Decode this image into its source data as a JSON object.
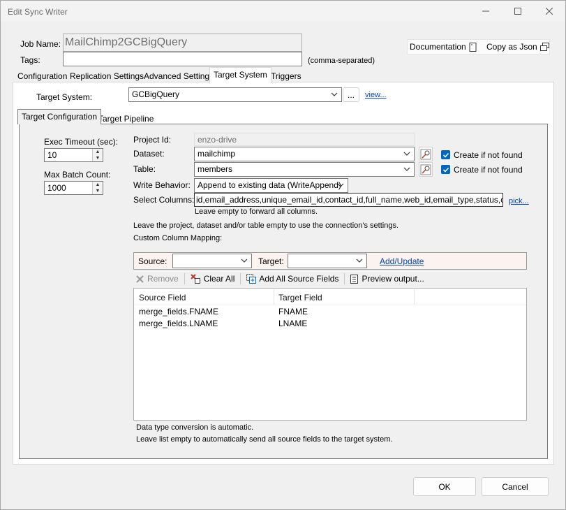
{
  "window": {
    "title": "Edit Sync Writer",
    "minimize_icon": "minimize-icon",
    "maximize_icon": "maximize-icon",
    "close_icon": "close-icon"
  },
  "header": {
    "job_name_label": "Job Name:",
    "job_name_value": "MailChimp2GCBigQuery",
    "tags_label": "Tags:",
    "tags_value": "",
    "tags_hint": "(comma-separated)",
    "documentation_label": "Documentation",
    "copy_json_label": "Copy as Json"
  },
  "main_tabs": [
    "Configuration",
    "Replication Settings",
    "Advanced Settings",
    "Target System",
    "Triggers"
  ],
  "target_system": {
    "label": "Target System:",
    "value": "GCBigQuery",
    "browse_label": "...",
    "view_link": "view..."
  },
  "sub_tabs": [
    "Target Configuration",
    "Target Pipeline"
  ],
  "config": {
    "exec_timeout_label": "Exec Timeout (sec):",
    "exec_timeout_value": "10",
    "max_batch_label": "Max Batch Count:",
    "max_batch_value": "1000",
    "project_id_label": "Project Id:",
    "project_id_value": "enzo-drive",
    "dataset_label": "Dataset:",
    "dataset_value": "mailchimp",
    "table_label": "Table:",
    "table_value": "members",
    "create_if_not_found_label": "Create if not found",
    "write_behavior_label": "Write Behavior:",
    "write_behavior_value": "Append to existing data (WriteAppend)",
    "select_columns_label": "Select Columns:",
    "select_columns_value": "id,email_address,unique_email_id,contact_id,full_name,web_id,email_type,status,consents_to",
    "pick_link": "pick...",
    "select_columns_hint": "Leave empty to forward all columns.",
    "connection_hint": "Leave the project, dataset and/or table empty to use the connection's settings.",
    "custom_mapping_label": "Custom Column Mapping:"
  },
  "mapping": {
    "source_label": "Source:",
    "source_value": "",
    "target_label": "Target:",
    "target_value": "",
    "add_update_link": "Add/Update",
    "toolbar": {
      "remove_label": "Remove",
      "clear_all_label": "Clear All",
      "add_all_label": "Add All Source Fields",
      "preview_label": "Preview output..."
    },
    "columns": [
      "Source Field",
      "Target Field"
    ],
    "rows": [
      {
        "source": "merge_fields.FNAME",
        "target": "FNAME"
      },
      {
        "source": "merge_fields.LNAME",
        "target": "LNAME"
      }
    ],
    "note1": "Data type conversion is automatic.",
    "note2": "Leave list empty to automatically send all source fields to the target system."
  },
  "footer": {
    "ok_label": "OK",
    "cancel_label": "Cancel"
  },
  "colors": {
    "accent": "#0067c0",
    "link": "#0645ad",
    "mapping_bar_bg": "#fbf3ef"
  }
}
